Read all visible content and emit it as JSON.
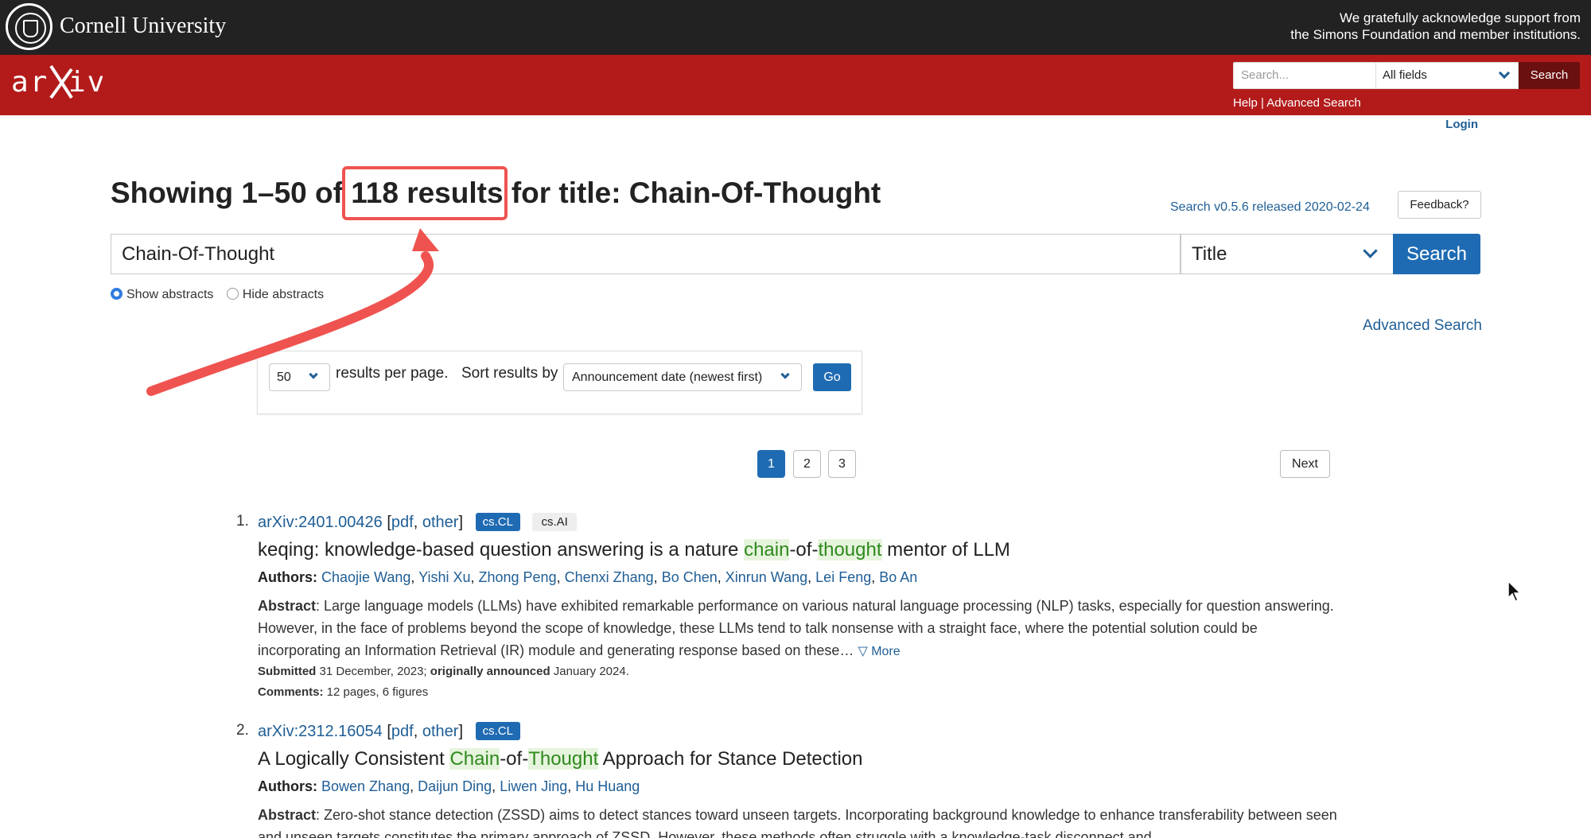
{
  "cornell": {
    "name": "Cornell University",
    "support_line1": "We gratefully acknowledge support from",
    "support_line2": "the Simons Foundation and member institutions."
  },
  "header": {
    "logo": "arXiv",
    "search_placeholder": "Search...",
    "field_value": "All fields",
    "search_button": "Search",
    "help": "Help",
    "separator": "|",
    "advanced": "Advanced Search",
    "login": "Login"
  },
  "page": {
    "title_prefix": "Showing 1–50 of",
    "title_count": "118 results",
    "title_suffix": "for title: Chain-Of-Thought",
    "version": "Search v0.5.6 released 2020-02-24",
    "feedback": "Feedback?",
    "query": "Chain-Of-Thought",
    "field": "Title",
    "search_button": "Search",
    "show_abstracts": "Show abstracts",
    "hide_abstracts": "Hide abstracts",
    "advanced_search": "Advanced Search",
    "per_page_value": "50",
    "per_page_label": "results per page.",
    "sort_label": "Sort results by",
    "sort_value": "Announcement date (newest first)",
    "go": "Go",
    "pages": [
      "1",
      "2",
      "3"
    ],
    "next": "Next"
  },
  "results": [
    {
      "num": "1.",
      "id": "arXiv:2401.00426",
      "bracket_open": "[",
      "pdf": "pdf",
      "comma": ",",
      "other": "other",
      "bracket_close": "]",
      "primary_tag": "cs.CL",
      "secondary_tag": "cs.AI",
      "title_a": "keqing: knowledge-based question answering is a nature ",
      "title_h1": "chain",
      "title_b": "-of-",
      "title_h2": "thought",
      "title_c": " mentor of LLM",
      "authors_label": "Authors:",
      "authors": [
        "Chaojie Wang",
        "Yishi Xu",
        "Zhong Peng",
        "Chenxi Zhang",
        "Bo Chen",
        "Xinrun Wang",
        "Lei Feng",
        "Bo An"
      ],
      "abstract_label": "Abstract",
      "abstract": ": Large language models (LLMs) have exhibited remarkable performance on various natural language processing (NLP) tasks, especially for question answering. However, in the face of problems beyond the scope of knowledge, these LLMs tend to talk nonsense with a straight face, where the potential solution could be incorporating an Information Retrieval (IR) module and generating response based on these…",
      "more": "▽ More",
      "submitted_label": "Submitted",
      "submitted": " 31 December, 2023; ",
      "announced_label": "originally announced",
      "announced": " January 2024.",
      "comments_label": "Comments:",
      "comments": " 12 pages, 6 figures"
    },
    {
      "num": "2.",
      "id": "arXiv:2312.16054",
      "bracket_open": "[",
      "pdf": "pdf",
      "comma": ",",
      "other": "other",
      "bracket_close": "]",
      "primary_tag": "cs.CL",
      "title_a": "A Logically Consistent ",
      "title_h1": "Chain",
      "title_b": "-of-",
      "title_h2": "Thought",
      "title_c": " Approach for Stance Detection",
      "authors_label": "Authors:",
      "authors": [
        "Bowen Zhang",
        "Daijun Ding",
        "Liwen Jing",
        "Hu Huang"
      ],
      "abstract_label": "Abstract",
      "abstract": ": Zero-shot stance detection (ZSSD) aims to detect stances toward unseen targets. Incorporating background knowledge to enhance transferability between seen and unseen targets constitutes the primary approach of ZSSD. However, these methods often struggle with a knowledge-task disconnect and"
    }
  ],
  "colors": {
    "arxiv_red": "#b31b1b",
    "cornell_dark": "#222222",
    "link_blue": "#1f5e96",
    "button_blue": "#1f6bb3",
    "annotation_red": "#ef5350",
    "highlight_green": "#2f8a1e"
  }
}
